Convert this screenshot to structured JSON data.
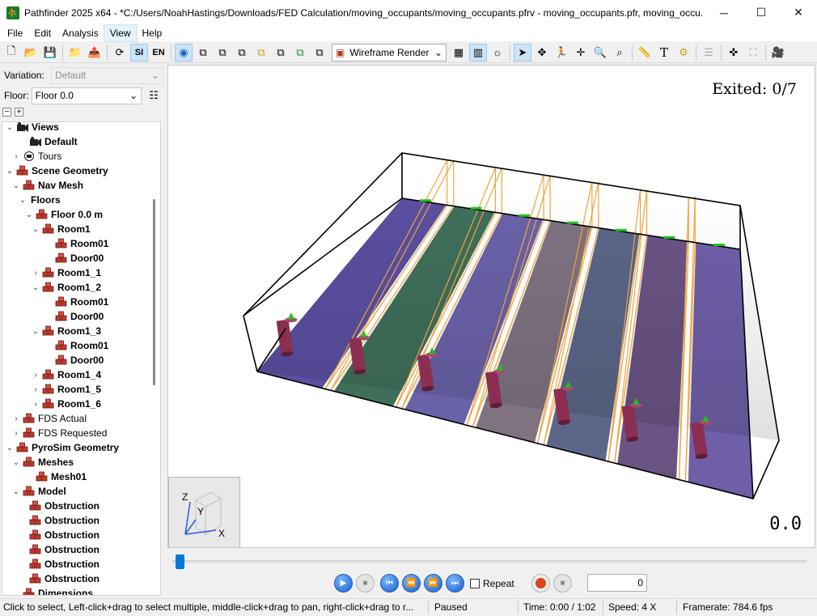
{
  "window": {
    "title": "Pathfinder 2025 x64 - *C:/Users/NoahHastings/Downloads/FED Calculation/moving_occupants/moving_occupants.pfrv - moving_occupants.pfr, moving_occu..."
  },
  "menu": [
    "File",
    "Edit",
    "Analysis",
    "View",
    "Help"
  ],
  "toolbar": {
    "si_label": "SI",
    "en_label": "EN",
    "render_mode": "Wireframe Render"
  },
  "left_panel": {
    "variation_label": "Variation:",
    "variation_value": "Default",
    "floor_label": "Floor:",
    "floor_value": "Floor 0.0",
    "tree": [
      {
        "label": "Views",
        "bold": true
      },
      {
        "label": "Default",
        "bold": true
      },
      {
        "label": "Tours",
        "bold": false
      },
      {
        "label": "Scene Geometry",
        "bold": true
      },
      {
        "label": "Nav Mesh",
        "bold": true
      },
      {
        "label": "Floors",
        "bold": true
      },
      {
        "label": "Floor 0.0 m",
        "bold": true
      },
      {
        "label": "Room1",
        "bold": true
      },
      {
        "label": "Room01",
        "bold": true
      },
      {
        "label": "Door00",
        "bold": true
      },
      {
        "label": "Room1_1",
        "bold": true
      },
      {
        "label": "Room1_2",
        "bold": true
      },
      {
        "label": "Room01",
        "bold": true
      },
      {
        "label": "Door00",
        "bold": true
      },
      {
        "label": "Room1_3",
        "bold": true
      },
      {
        "label": "Room01",
        "bold": true
      },
      {
        "label": "Door00",
        "bold": true
      },
      {
        "label": "Room1_4",
        "bold": true
      },
      {
        "label": "Room1_5",
        "bold": true
      },
      {
        "label": "Room1_6",
        "bold": true
      },
      {
        "label": "FDS Actual",
        "bold": false
      },
      {
        "label": "FDS Requested",
        "bold": false
      },
      {
        "label": "PyroSim Geometry",
        "bold": true
      },
      {
        "label": "Meshes",
        "bold": true
      },
      {
        "label": "Mesh01",
        "bold": true
      },
      {
        "label": "Model",
        "bold": true
      },
      {
        "label": "Obstruction",
        "bold": true
      },
      {
        "label": "Obstruction",
        "bold": true
      },
      {
        "label": "Obstruction",
        "bold": true
      },
      {
        "label": "Obstruction",
        "bold": true
      },
      {
        "label": "Obstruction",
        "bold": true
      },
      {
        "label": "Obstruction",
        "bold": true
      },
      {
        "label": "Dimensions",
        "bold": true
      }
    ]
  },
  "viewport": {
    "exited_text": "Exited: 0/7",
    "time_display": "0.0",
    "axis_labels": {
      "z": "Z",
      "y": "Y",
      "x": "X"
    }
  },
  "playback": {
    "repeat_label": "Repeat",
    "frame_value": "0",
    "progress": 0.0
  },
  "status": {
    "hint": "Click to select, Left-click+drag to select multiple, middle-click+drag to pan, right-click+drag to r...",
    "state": "Paused",
    "time": "Time: 0:00 / 1:02",
    "speed": "Speed: 4 X",
    "framerate": "Framerate: 784.6 fps"
  },
  "colors": {
    "accent": "#0078d7",
    "room_colors": [
      "#5a4fa0",
      "#3f6f5a",
      "#6a62a8",
      "#7f7382",
      "#5b6688",
      "#6a5484",
      "#6f5fa8"
    ],
    "occupant": "#8b2f52",
    "door_outline": "#f2a33a",
    "exit_marker": "#1ec21e"
  }
}
